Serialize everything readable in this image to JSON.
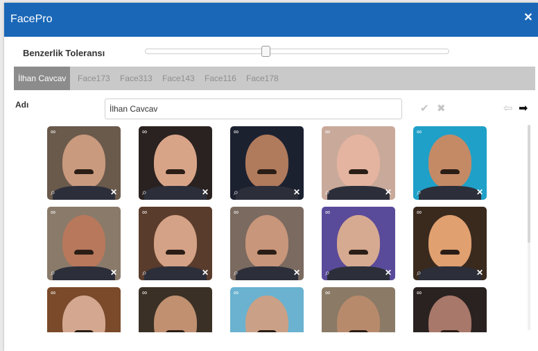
{
  "window": {
    "title": "FacePro",
    "close_icon": "close-icon"
  },
  "tolerance": {
    "label": "Benzerlik Toleransı",
    "value_fraction": 0.41
  },
  "tabs": [
    {
      "label": "İlhan Cavcav",
      "active": true
    },
    {
      "label": "Face173"
    },
    {
      "label": "Face313"
    },
    {
      "label": "Face143"
    },
    {
      "label": "Face116"
    },
    {
      "label": "Face178"
    }
  ],
  "name_field": {
    "label": "Adı",
    "value": "İlhan Cavcav"
  },
  "actions": {
    "confirm_icon": "check-icon",
    "cancel_icon": "x-icon",
    "prev_icon": "arrow-left-icon",
    "next_icon": "arrow-right-icon"
  },
  "thumbnails": {
    "count": 15,
    "icons": {
      "top": "face-tag-icon",
      "bottom_left": "zoom-icon",
      "bottom_right": "delete-icon"
    }
  },
  "colors": {
    "header": "#1a67b7",
    "tabbar": "#c9c9c9",
    "active_tab": "#8c8c8c"
  }
}
